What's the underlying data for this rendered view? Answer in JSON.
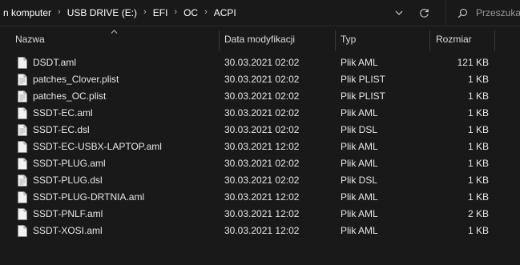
{
  "breadcrumb": {
    "items": [
      "n komputer",
      "USB DRIVE (E:)",
      "EFI",
      "OC",
      "ACPI"
    ],
    "separator": "›"
  },
  "search": {
    "placeholder": "Przeszukaj: ACPI",
    "icon": "search-icon"
  },
  "columns": {
    "name": "Nazwa",
    "date": "Data modyfikacji",
    "type": "Typ",
    "size": "Rozmiar"
  },
  "files": [
    {
      "name": "DSDT.aml",
      "date": "30.03.2021 02:02",
      "type": "Plik AML",
      "size": "121 KB"
    },
    {
      "name": "patches_Clover.plist",
      "date": "30.03.2021 02:02",
      "type": "Plik PLIST",
      "size": "1 KB"
    },
    {
      "name": "patches_OC.plist",
      "date": "30.03.2021 02:02",
      "type": "Plik PLIST",
      "size": "1 KB"
    },
    {
      "name": "SSDT-EC.aml",
      "date": "30.03.2021 02:02",
      "type": "Plik AML",
      "size": "1 KB"
    },
    {
      "name": "SSDT-EC.dsl",
      "date": "30.03.2021 02:02",
      "type": "Plik DSL",
      "size": "1 KB"
    },
    {
      "name": "SSDT-EC-USBX-LAPTOP.aml",
      "date": "30.03.2021 12:02",
      "type": "Plik AML",
      "size": "1 KB"
    },
    {
      "name": "SSDT-PLUG.aml",
      "date": "30.03.2021 02:02",
      "type": "Plik AML",
      "size": "1 KB"
    },
    {
      "name": "SSDT-PLUG.dsl",
      "date": "30.03.2021 02:02",
      "type": "Plik DSL",
      "size": "1 KB"
    },
    {
      "name": "SSDT-PLUG-DRTNIA.aml",
      "date": "30.03.2021 12:02",
      "type": "Plik AML",
      "size": "1 KB"
    },
    {
      "name": "SSDT-PNLF.aml",
      "date": "30.03.2021 12:02",
      "type": "Plik AML",
      "size": "2 KB"
    },
    {
      "name": "SSDT-XOSI.aml",
      "date": "30.03.2021 12:02",
      "type": "Plik AML",
      "size": "1 KB"
    }
  ],
  "colors": {
    "background": "#191919",
    "text": "#e6e6e6",
    "separator": "#3a3a3a"
  }
}
